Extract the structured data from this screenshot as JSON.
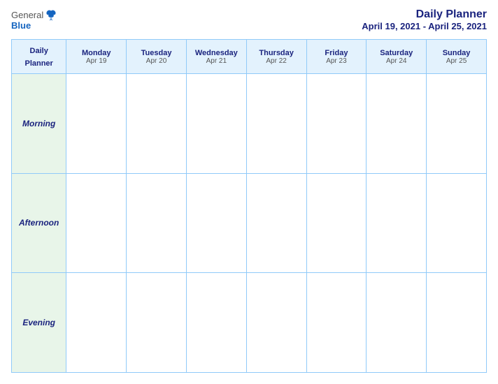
{
  "logo": {
    "general": "General",
    "blue": "Blue"
  },
  "header": {
    "title": "Daily Planner",
    "date_range": "April 19, 2021 - April 25, 2021"
  },
  "table": {
    "label_col": {
      "line1": "Daily",
      "line2": "Planner"
    },
    "days": [
      {
        "name": "Monday",
        "date": "Apr 19"
      },
      {
        "name": "Tuesday",
        "date": "Apr 20"
      },
      {
        "name": "Wednesday",
        "date": "Apr 21"
      },
      {
        "name": "Thursday",
        "date": "Apr 22"
      },
      {
        "name": "Friday",
        "date": "Apr 23"
      },
      {
        "name": "Saturday",
        "date": "Apr 24"
      },
      {
        "name": "Sunday",
        "date": "Apr 25"
      }
    ],
    "rows": [
      {
        "label": "Morning"
      },
      {
        "label": "Afternoon"
      },
      {
        "label": "Evening"
      }
    ]
  }
}
